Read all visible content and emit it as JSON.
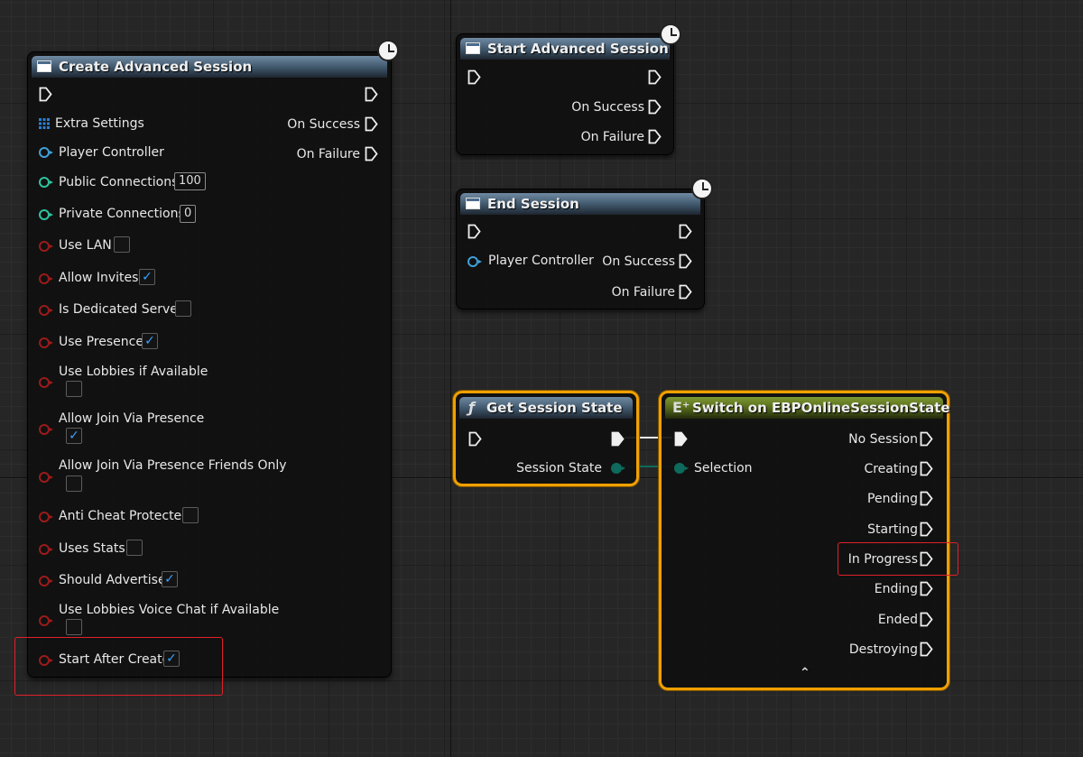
{
  "nodes": {
    "create_session": {
      "title": "Create Advanced Session",
      "extra_settings": "Extra Settings",
      "player_controller": "Player Controller",
      "public_connections": "Public Connections",
      "public_connections_value": "100",
      "private_connections": "Private Connections",
      "private_connections_value": "0",
      "use_lan": "Use LAN",
      "allow_invites": "Allow Invites",
      "is_dedicated_server": "Is Dedicated Server",
      "use_presence": "Use Presence",
      "use_lobbies": "Use Lobbies if Available",
      "allow_join_presence": "Allow Join Via Presence",
      "allow_join_presence_friends": "Allow Join Via Presence Friends Only",
      "anti_cheat": "Anti Cheat Protected",
      "uses_stats": "Uses Stats",
      "should_advertise": "Should Advertise",
      "use_lobbies_voice": "Use Lobbies Voice Chat if Available",
      "start_after_create": "Start After Create",
      "on_success": "On Success",
      "on_failure": "On Failure",
      "checkboxes": {
        "use_lan": false,
        "allow_invites": true,
        "is_dedicated_server": false,
        "use_presence": true,
        "use_lobbies": false,
        "allow_join_presence": true,
        "allow_join_presence_friends": false,
        "anti_cheat": false,
        "uses_stats": false,
        "should_advertise": true,
        "use_lobbies_voice": false,
        "start_after_create": true
      }
    },
    "start_session": {
      "title": "Start Advanced Session",
      "on_success": "On Success",
      "on_failure": "On Failure"
    },
    "end_session": {
      "title": "End Session",
      "player_controller": "Player Controller",
      "on_success": "On Success",
      "on_failure": "On Failure"
    },
    "get_state": {
      "title": "Get Session State",
      "session_state": "Session State"
    },
    "switch": {
      "title": "Switch on EBPOnlineSessionState",
      "selection": "Selection",
      "outputs": [
        "No Session",
        "Creating",
        "Pending",
        "Starting",
        "In Progress",
        "Ending",
        "Ended",
        "Destroying"
      ]
    }
  },
  "colors": {
    "exec_pin": "#f0f0f0",
    "object_pin": "#3fa0d8",
    "int_pin": "#2ec4a0",
    "bool_pin": "#9c1b1b",
    "enum_pin": "#0d6a5c",
    "selection_border": "#f0a000",
    "highlight": "#e0202a",
    "check": "#3aa0ff"
  },
  "icons": {
    "latent": "clock-icon",
    "function": "function-icon",
    "switch": "switch-icon",
    "struct": "struct-grid-icon",
    "expand": "chevron-up-icon"
  }
}
